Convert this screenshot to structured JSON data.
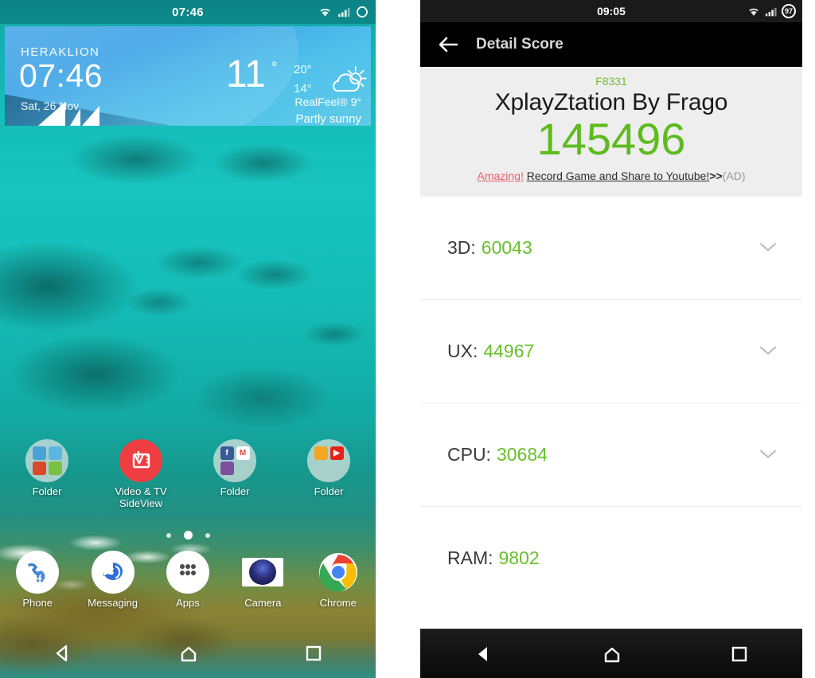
{
  "left_phone": {
    "statusbar": {
      "time": "07:46",
      "icons": [
        "wifi-icon",
        "signal-icon",
        "battery-ring-icon"
      ]
    },
    "weather_widget": {
      "city": "HERAKLION",
      "clock": "07:46",
      "date": "Sat, 26 Nov",
      "temperature": "11",
      "degree": "°",
      "high": "20°",
      "low": "14°",
      "realfeel": "RealFeel® 9°",
      "condition": "Partly sunny",
      "icon": "partly-sunny-icon"
    },
    "apps": [
      {
        "label": "Folder",
        "type": "folder",
        "minis": [
          {
            "bg": "#4aa3d8",
            "glyph": ""
          },
          {
            "bg": "#5bb7e0",
            "glyph": ""
          },
          {
            "bg": "#d94a2a",
            "glyph": ""
          },
          {
            "bg": "#7ac043",
            "glyph": ""
          }
        ]
      },
      {
        "label": "Video & TV SideView",
        "type": "app",
        "bg": "#ef3e42",
        "icon": "video-tv-sideview-icon"
      },
      {
        "label": "Folder",
        "type": "folder",
        "minis": [
          {
            "bg": "#3b5998",
            "glyph": "f"
          },
          {
            "bg": "#ffffff",
            "glyph": "M"
          },
          {
            "bg": "#7b519d",
            "glyph": ""
          },
          {
            "bg": "transparent",
            "glyph": ""
          }
        ]
      },
      {
        "label": "Folder",
        "type": "folder",
        "minis": [
          {
            "bg": "#f5a623",
            "glyph": ""
          },
          {
            "bg": "#e62117",
            "glyph": ""
          },
          {
            "bg": "transparent",
            "glyph": ""
          },
          {
            "bg": "transparent",
            "glyph": ""
          }
        ]
      }
    ],
    "page_dots": {
      "count": 3,
      "active_index": 1
    },
    "dock": [
      {
        "label": "Phone",
        "icon": "phone-icon",
        "bg": "#ffffff",
        "fg": "#3f7fd0"
      },
      {
        "label": "Messaging",
        "icon": "messaging-icon",
        "bg": "#ffffff",
        "fg": "#2d6fd6"
      },
      {
        "label": "Apps",
        "icon": "apps-grid-icon",
        "bg": "#ffffff",
        "fg": "#4a4a4a"
      },
      {
        "label": "Camera",
        "icon": "camera-icon",
        "bg": "#ffffff",
        "fg": "#1a2a5a"
      },
      {
        "label": "Chrome",
        "icon": "chrome-icon",
        "bg": "#ffffff",
        "fg": "#4285f4"
      }
    ],
    "navbar": [
      {
        "name": "back-icon",
        "label": "Back"
      },
      {
        "name": "home-icon",
        "label": "Home"
      },
      {
        "name": "recents-icon",
        "label": "Recents"
      }
    ]
  },
  "right_phone": {
    "statusbar": {
      "time": "09:05",
      "battery_percent": "97",
      "icons": [
        "wifi-icon",
        "signal-icon",
        "battery-badge-icon"
      ]
    },
    "appbar": {
      "back_icon": "arrow-back-icon",
      "title": "Detail Score"
    },
    "summary": {
      "model": "F8331",
      "device_name": "XplayZtation By Frago",
      "total_score": "145496"
    },
    "ad": {
      "highlight": "Amazing!",
      "text": "Record Game and Share to Youtube!",
      "arrow": ">>",
      "tag": "(AD)"
    },
    "scores": [
      {
        "label": "3D:",
        "value": "60043",
        "chevron": "chevron-down-icon"
      },
      {
        "label": "UX:",
        "value": "44967",
        "chevron": "chevron-down-icon"
      },
      {
        "label": "CPU:",
        "value": "30684",
        "chevron": "chevron-down-icon"
      },
      {
        "label": "RAM:",
        "value": "9802",
        "chevron": "chevron-down-icon"
      }
    ],
    "navbar": [
      {
        "name": "back-icon",
        "label": "Back"
      },
      {
        "name": "home-icon",
        "label": "Home"
      },
      {
        "name": "recents-icon",
        "label": "Recents"
      }
    ]
  },
  "colors": {
    "score_green": "#5dbb1e",
    "row_green": "#66c02a",
    "model_green": "#6fbe2e",
    "ad_red": "#e8616d",
    "widget_blue": "#4aa8e8",
    "wallpaper_teal": "#16bfb9"
  }
}
